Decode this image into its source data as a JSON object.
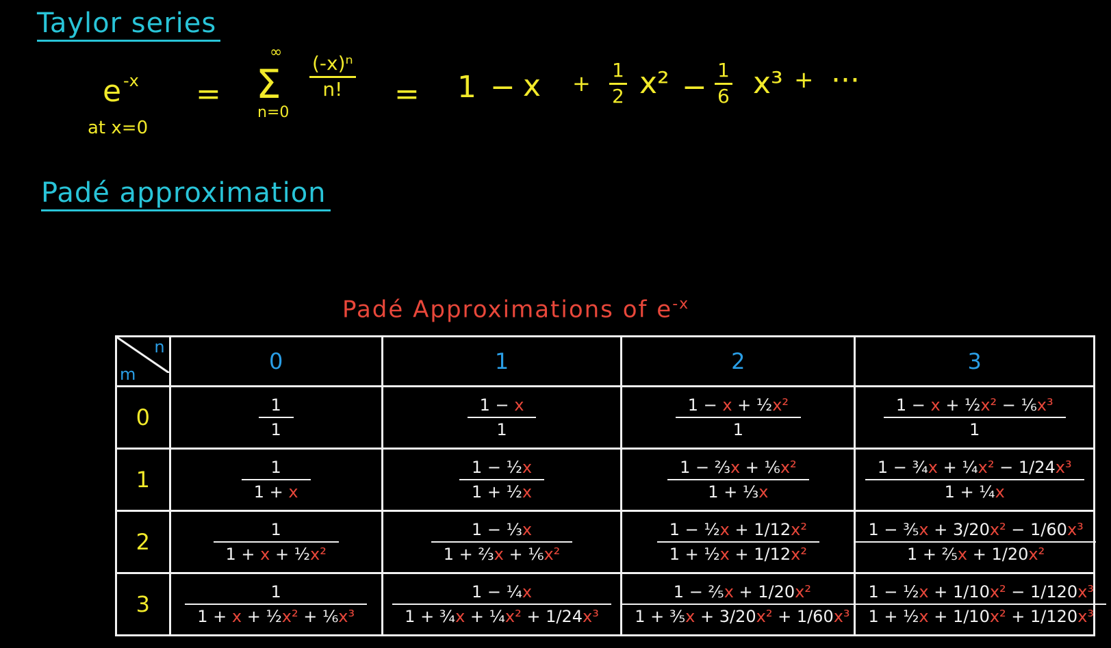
{
  "headings": {
    "taylor": "Taylor series",
    "pade": "Padé approximation"
  },
  "taylor_formula": {
    "lhs_base": "e",
    "lhs_exp": "-x",
    "lhs_note": "at x=0",
    "eq": "=",
    "sum_symbol": "Σ",
    "sum_upper": "∞",
    "sum_lower": "n=0",
    "sum_num": "(-x)ⁿ",
    "sum_den": "n!",
    "eq2": "=",
    "t1": "1",
    "op1": "−",
    "t2": "x",
    "op2": "+",
    "t3_num": "1",
    "t3_den": "2",
    "t3_var": "x²",
    "op3": "−",
    "t4_num": "1",
    "t4_den": "6",
    "t4_var": "x³",
    "op4": "+",
    "ellipsis": "···"
  },
  "table": {
    "title": "Padé Approximations of e",
    "title_exp": "-x",
    "corner_n": "n",
    "corner_m": "m",
    "col_labels": [
      "0",
      "1",
      "2",
      "3"
    ],
    "row_labels": [
      "0",
      "1",
      "2",
      "3"
    ],
    "cells": [
      [
        {
          "num": "1",
          "den": "1"
        },
        {
          "num": "1 − x",
          "den": "1"
        },
        {
          "num": "1 − x + ½x²",
          "den": "1"
        },
        {
          "num": "1 − x + ½x² − ⅙x³",
          "den": "1"
        }
      ],
      [
        {
          "num": "1",
          "den": "1 + x"
        },
        {
          "num": "1 − ½x",
          "den": "1 + ½x"
        },
        {
          "num": "1 − ⅔x + ⅙x²",
          "den": "1 + ⅓x"
        },
        {
          "num": "1 − ¾x + ¼x² − 1/24x³",
          "den": "1 + ¼x"
        }
      ],
      [
        {
          "num": "1",
          "den": "1 + x + ½x²"
        },
        {
          "num": "1 − ⅓x",
          "den": "1 + ⅔x + ⅙x²"
        },
        {
          "num": "1 − ½x + 1/12x²",
          "den": "1 + ½x + 1/12x²"
        },
        {
          "num": "1 − ⅗x + 3/20x² − 1/60x³",
          "den": "1 + ⅖x + 1/20x²"
        }
      ],
      [
        {
          "num": "1",
          "den": "1 + x + ½x² + ⅙x³"
        },
        {
          "num": "1 − ¼x",
          "den": "1 + ¾x + ¼x² + 1/24x³"
        },
        {
          "num": "1 − ⅖x + 1/20x²",
          "den": "1 + ⅗x + 3/20x² + 1/60x³"
        },
        {
          "num": "1 − ½x + 1/10x² − 1/120x³",
          "den": "1 + ½x + 1/10x² + 1/120x³"
        }
      ]
    ]
  },
  "colors": {
    "heading": "#29c4d8",
    "formula": "#f2ea2a",
    "title": "#e8473a",
    "variable": "#e8473a",
    "column_header": "#2a9ee6",
    "row_header": "#f2ea2a",
    "grid": "#f2f2f2",
    "background": "#000000"
  }
}
